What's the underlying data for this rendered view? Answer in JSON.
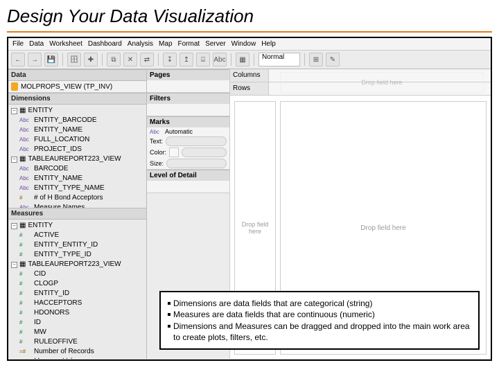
{
  "slide": {
    "title": "Design Your Data Visualization"
  },
  "menubar": [
    "File",
    "Data",
    "Worksheet",
    "Dashboard",
    "Analysis",
    "Map",
    "Format",
    "Server",
    "Window",
    "Help"
  ],
  "toolbar": {
    "icons": [
      "back-icon",
      "forward-icon",
      "save-icon",
      "datasource-icon",
      "new-sheet-icon",
      "duplicate-icon",
      "clear-icon",
      "swap-icon",
      "sort-asc-icon",
      "sort-desc-icon",
      "group-icon",
      "abc-icon",
      "presentation-icon"
    ],
    "abc_label": "Abc",
    "fit_select": "Normal",
    "fit_arrow": "▾",
    "zoom_label": "",
    "highlighter": "✎"
  },
  "sidebar": {
    "data_hdr": "Data",
    "datasource": "MOLPROPS_VIEW (TP_INV)",
    "dimensions_hdr": "Dimensions",
    "dim_tree": [
      {
        "expand": "−",
        "type": "tbl",
        "label": "ENTITY"
      },
      {
        "indent": 1,
        "type": "Abc",
        "label": "ENTITY_BARCODE"
      },
      {
        "indent": 1,
        "type": "Abc",
        "label": "ENTITY_NAME"
      },
      {
        "indent": 1,
        "type": "Abc",
        "label": "FULL_LOCATION"
      },
      {
        "indent": 1,
        "type": "Abc",
        "label": "PROJECT_IDS"
      },
      {
        "expand": "−",
        "type": "tbl",
        "label": "TABLEAUREPORT223_VIEW"
      },
      {
        "indent": 1,
        "type": "Abc",
        "label": "BARCODE"
      },
      {
        "indent": 1,
        "type": "Abc",
        "label": "ENTITY_NAME"
      },
      {
        "indent": 1,
        "type": "Abc",
        "label": "ENTITY_TYPE_NAME"
      },
      {
        "indent": 1,
        "type": "#",
        "label": "# of H Bond Acceptors",
        "calc": true
      },
      {
        "indent": 1,
        "type": "Abc",
        "label": "Measure Names"
      }
    ],
    "measures_hdr": "Measures",
    "meas_tree": [
      {
        "expand": "−",
        "type": "tbl",
        "label": "ENTITY"
      },
      {
        "indent": 1,
        "type": "#",
        "label": "ACTIVE"
      },
      {
        "indent": 1,
        "type": "#",
        "label": "ENTITY_ENTITY_ID"
      },
      {
        "indent": 1,
        "type": "#",
        "label": "ENTITY_TYPE_ID"
      },
      {
        "expand": "−",
        "type": "tbl",
        "label": "TABLEAUREPORT223_VIEW"
      },
      {
        "indent": 1,
        "type": "#",
        "label": "CID"
      },
      {
        "indent": 1,
        "type": "#",
        "label": "CLOGP"
      },
      {
        "indent": 1,
        "type": "#",
        "label": "ENTITY_ID"
      },
      {
        "indent": 1,
        "type": "#",
        "label": "HACCEPTORS"
      },
      {
        "indent": 1,
        "type": "#",
        "label": "HDONORS"
      },
      {
        "indent": 1,
        "type": "#",
        "label": "ID"
      },
      {
        "indent": 1,
        "type": "#",
        "label": "MW"
      },
      {
        "indent": 1,
        "type": "#",
        "label": "RULEOFFIVE"
      },
      {
        "indent": 1,
        "type": "=#",
        "label": "Number of Records",
        "calc": true
      },
      {
        "indent": 1,
        "type": "#",
        "label": "Measure Values"
      }
    ]
  },
  "shelves": {
    "pages": "Pages",
    "filters": "Filters",
    "marks": "Marks",
    "marks_type_prefix": "Abc",
    "marks_type": "Automatic",
    "text_lbl": "Text:",
    "color_lbl": "Color:",
    "size_lbl": "Size:",
    "lod": "Level of Detail"
  },
  "rowscols": {
    "columns": "Columns",
    "rows": "Rows"
  },
  "canvas": {
    "drop_top": "Drop field here",
    "drop_left": "Drop field here",
    "drop_main": "Drop field here"
  },
  "callout": {
    "b1": "Dimensions are data fields that are categorical (string)",
    "b2": "Measures are data fields that are continuous (numeric)",
    "b3": "Dimensions and Measures can be dragged and dropped into the main work area to create plots, filters, etc."
  }
}
